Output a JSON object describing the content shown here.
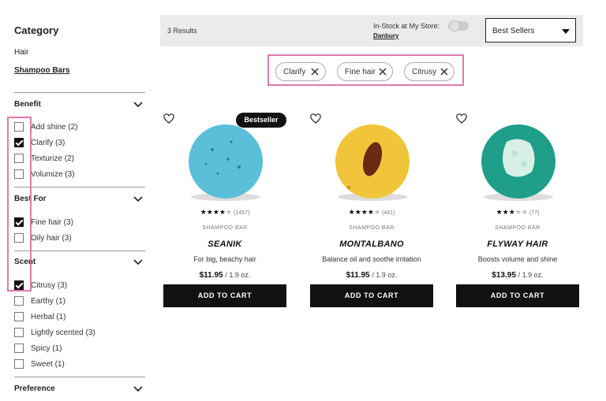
{
  "sidebar": {
    "category_title": "Category",
    "category_parent": "Hair",
    "category_current": "Shampoo Bars",
    "sections": [
      {
        "title": "Benefit",
        "options": [
          {
            "label": "Add shine (2)",
            "checked": false
          },
          {
            "label": "Clarify (3)",
            "checked": true
          },
          {
            "label": "Texturize (2)",
            "checked": false
          },
          {
            "label": "Volumize (3)",
            "checked": false
          }
        ]
      },
      {
        "title": "Best For",
        "options": [
          {
            "label": "Fine hair (3)",
            "checked": true
          },
          {
            "label": "Oily hair (3)",
            "checked": false
          }
        ]
      },
      {
        "title": "Scent",
        "options": [
          {
            "label": "Citrusy (3)",
            "checked": true
          },
          {
            "label": "Earthy (1)",
            "checked": false
          },
          {
            "label": "Herbal (1)",
            "checked": false
          },
          {
            "label": "Lightly scented (3)",
            "checked": false
          },
          {
            "label": "Spicy (1)",
            "checked": false
          },
          {
            "label": "Sweet (1)",
            "checked": false
          }
        ]
      },
      {
        "title": "Preference",
        "options": []
      }
    ]
  },
  "topbar": {
    "results": "3 Results",
    "instock_label": "In-Stock at My Store:",
    "store": "Danbury",
    "sort_value": "Best Sellers"
  },
  "chips": [
    {
      "label": "Clarify"
    },
    {
      "label": "Fine hair"
    },
    {
      "label": "Citrusy"
    }
  ],
  "products": [
    {
      "badge": "Bestseller",
      "rating_count": "(1457)",
      "rating": 4.5,
      "kind": "SHAMPOO BAR",
      "name": "SEANIK",
      "desc": "For big, beachy hair",
      "price": "$11.95",
      "unit": "/ 1.9 oz.",
      "cta": "ADD TO CART",
      "color": "#5bbfd9"
    },
    {
      "badge": "",
      "rating_count": "(441)",
      "rating": 4.5,
      "kind": "SHAMPOO BAR",
      "name": "MONTALBANO",
      "desc": "Balance oil and soothe irritation",
      "price": "$11.95",
      "unit": "/ 1.9 oz.",
      "cta": "ADD TO CART",
      "color": "#f0c53a"
    },
    {
      "badge": "",
      "rating_count": "(77)",
      "rating": 3.5,
      "kind": "SHAMPOO BAR",
      "name": "FLYWAY HAIR",
      "desc": "Boosts volume and shine",
      "price": "$13.95",
      "unit": "/ 1.9 oz.",
      "cta": "ADD TO CART",
      "color": "#1f9e8a"
    }
  ],
  "colors": {
    "highlight": "#e07ab0",
    "topbar_bg": "#ebebeb",
    "button_bg": "#111111"
  }
}
